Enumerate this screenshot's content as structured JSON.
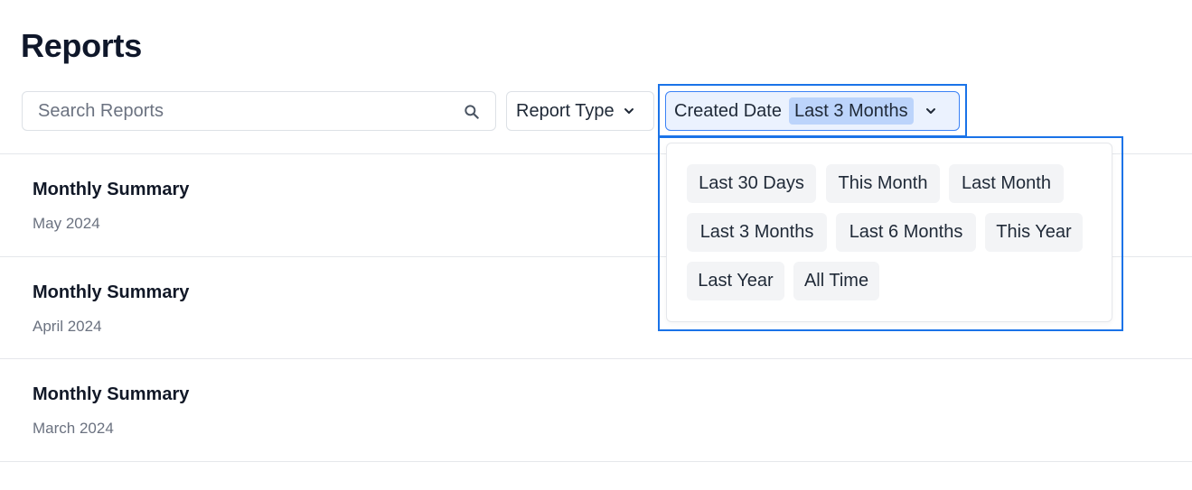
{
  "page": {
    "title": "Reports"
  },
  "search": {
    "placeholder": "Search Reports",
    "value": ""
  },
  "filters": {
    "report_type": {
      "label": "Report Type"
    },
    "created_date": {
      "label": "Created Date",
      "selected": "Last 3 Months"
    }
  },
  "date_options": [
    "Last 30 Days",
    "This Month",
    "Last Month",
    "Last 3 Months",
    "Last 6 Months",
    "This Year",
    "Last Year",
    "All Time"
  ],
  "reports": [
    {
      "title": "Monthly Summary",
      "date": "May 2024"
    },
    {
      "title": "Monthly Summary",
      "date": "April 2024"
    },
    {
      "title": "Monthly Summary",
      "date": "March 2024"
    }
  ],
  "colors": {
    "accent": "#1a73e8",
    "selected_chip": "#bcd4fb",
    "option_bg": "#f3f4f6"
  }
}
